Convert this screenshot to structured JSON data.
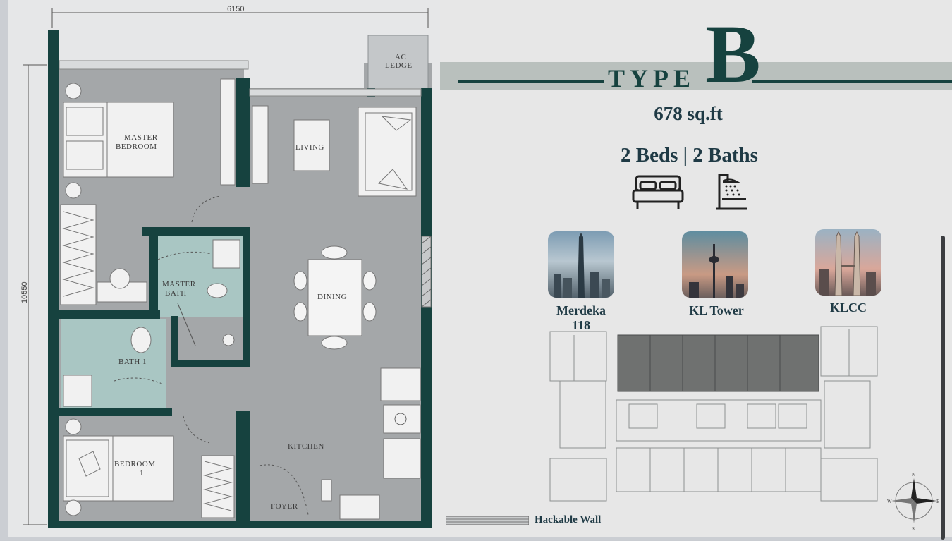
{
  "plan": {
    "width_dim": "6150",
    "height_dim": "10550",
    "rooms": {
      "ac_ledge_1": "AC",
      "ac_ledge_2": "LEDGE",
      "master_bedroom_1": "MASTER",
      "master_bedroom_2": "BEDROOM",
      "living": "LIVING",
      "master_bath_1": "MASTER",
      "master_bath_2": "BATH",
      "dining": "DINING",
      "bath1": "BATH 1",
      "kitchen": "KITCHEN",
      "bedroom1_1": "BEDROOM",
      "bedroom1_2": "1",
      "foyer": "FOYER"
    }
  },
  "unit": {
    "type_word": "TYPE",
    "type_letter": "B",
    "area": "678 sq.ft",
    "beds_baths": "2 Beds | 2 Baths"
  },
  "landmarks": [
    {
      "name": "Merdeka 118",
      "line1": "Merdeka",
      "line2": "118"
    },
    {
      "name": "KL Tower"
    },
    {
      "name": "KLCC"
    }
  ],
  "legend": {
    "hackable_wall": "Hackable Wall"
  },
  "compass": {
    "n": "N",
    "s": "S",
    "w": "W",
    "e": "E"
  },
  "colors": {
    "wall": "#16423f",
    "floor": "#a5a8aa",
    "bath": "#a9c6c3",
    "type_line": "#16423f",
    "highlight_units": "#6f7170"
  }
}
